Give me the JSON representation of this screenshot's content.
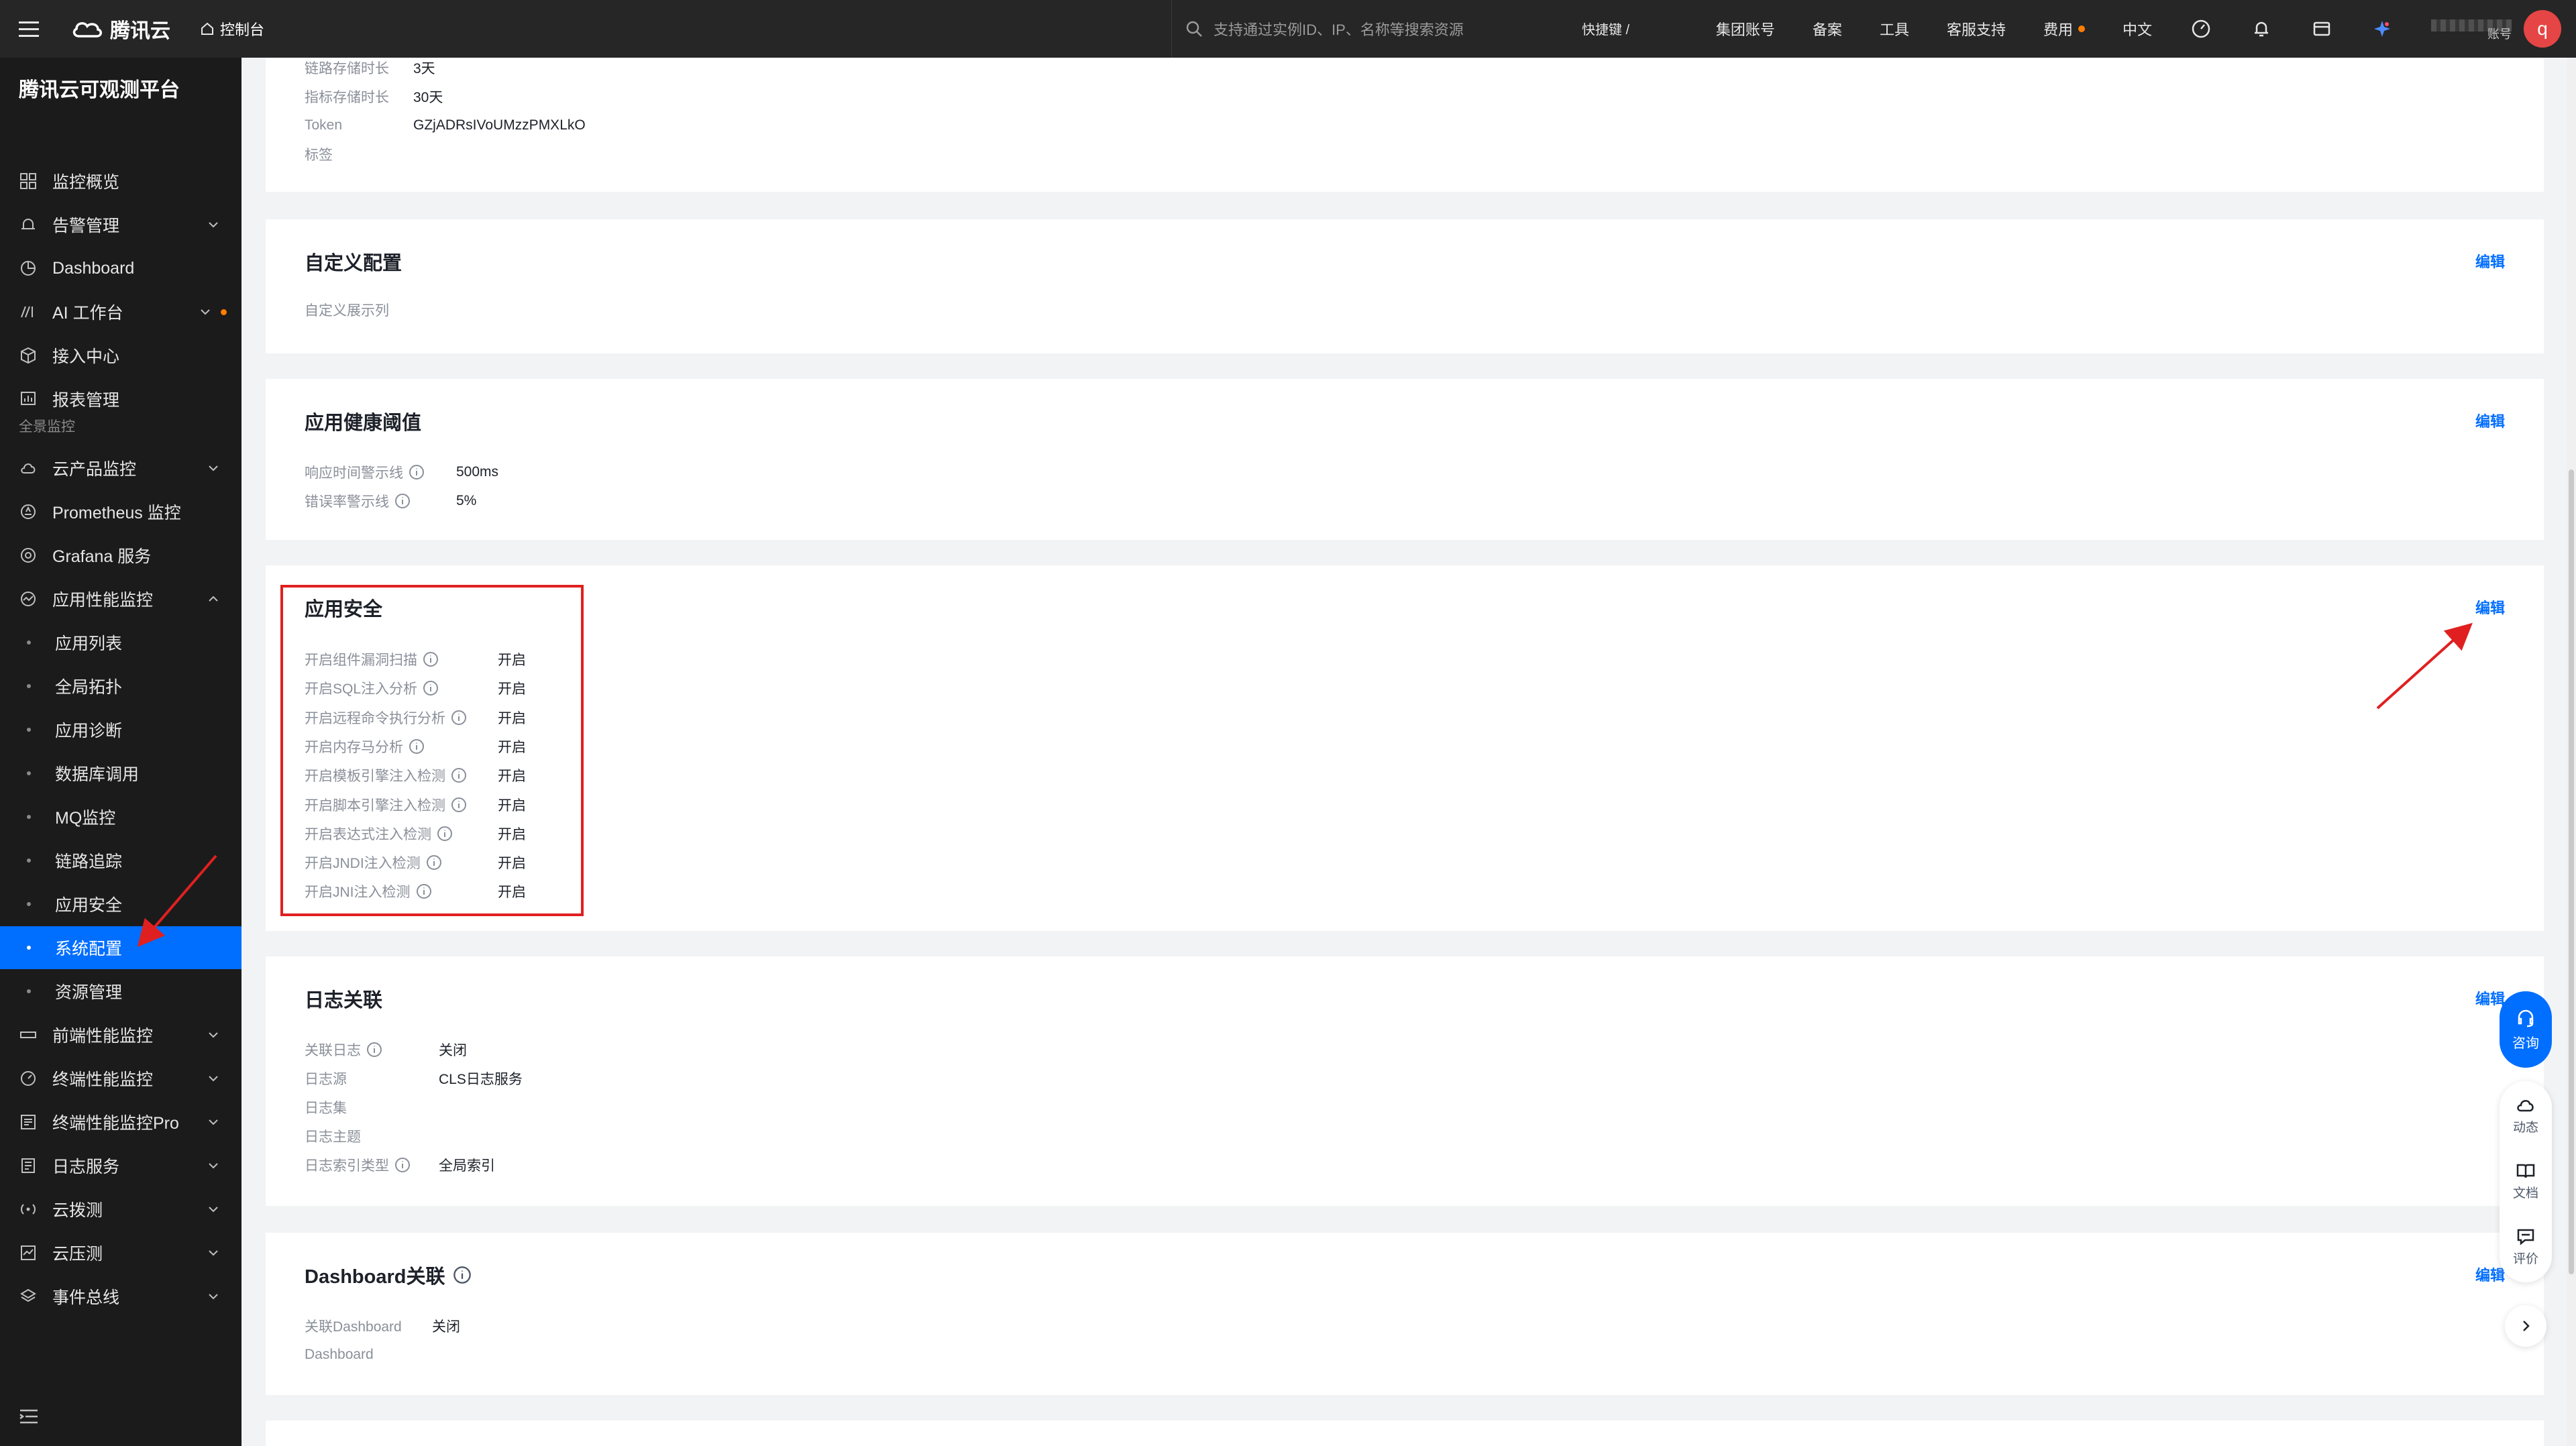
{
  "topbar": {
    "brand": "腾讯云",
    "console": "控制台",
    "search_placeholder": "支持通过实例ID、IP、名称等搜索资源",
    "shortcut": "快捷键 /",
    "links": [
      "集团账号",
      "备案",
      "工具",
      "客服支持",
      "费用",
      "中文"
    ],
    "account_label": "账号",
    "avatar_letter": "q"
  },
  "sidebar": {
    "title": "腾讯云可观测平台",
    "items": [
      {
        "label": "监控概览",
        "icon": "dashboard-grid-icon"
      },
      {
        "label": "告警管理",
        "icon": "alarm-icon",
        "expandable": true
      },
      {
        "label": "Dashboard",
        "icon": "pie-chart-icon"
      },
      {
        "label": "AI 工作台",
        "icon": "ai-icon",
        "expandable": true,
        "badge_dot": true
      },
      {
        "label": "接入中心",
        "icon": "cube-icon"
      },
      {
        "label": "报表管理",
        "icon": "report-icon"
      }
    ],
    "section_label": "全景监控",
    "section_items": [
      {
        "label": "云产品监控",
        "icon": "cloud-icon",
        "expandable": true
      },
      {
        "label": "Prometheus 监控",
        "icon": "prometheus-icon"
      },
      {
        "label": "Grafana 服务",
        "icon": "grafana-icon"
      },
      {
        "label": "应用性能监控",
        "icon": "apm-icon",
        "expanded": true
      }
    ],
    "sub_items": [
      {
        "label": "应用列表"
      },
      {
        "label": "全局拓扑"
      },
      {
        "label": "应用诊断"
      },
      {
        "label": "数据库调用"
      },
      {
        "label": "MQ监控"
      },
      {
        "label": "链路追踪"
      },
      {
        "label": "应用安全"
      },
      {
        "label": "系统配置",
        "active": true
      },
      {
        "label": "资源管理"
      }
    ],
    "more_items": [
      {
        "label": "前端性能监控",
        "icon": "rum-icon",
        "expandable": true
      },
      {
        "label": "终端性能监控",
        "icon": "gauge-icon",
        "expandable": true
      },
      {
        "label": "终端性能监控Pro",
        "icon": "terminal-pro-icon",
        "expandable": true
      },
      {
        "label": "日志服务",
        "icon": "log-icon",
        "expandable": true
      },
      {
        "label": "云拨测",
        "icon": "probe-icon",
        "expandable": true
      },
      {
        "label": "云压测",
        "icon": "pressure-test-icon",
        "expandable": true
      },
      {
        "label": "事件总线",
        "icon": "event-bus-icon",
        "expandable": true
      }
    ]
  },
  "basic": {
    "rows": [
      {
        "k": "链路存储时长",
        "v": "3天"
      },
      {
        "k": "指标存储时长",
        "v": "30天"
      },
      {
        "k": "Token",
        "v": "GZjADRsIVoUMzzPMXLkO"
      },
      {
        "k": "标签",
        "v": ""
      }
    ]
  },
  "custom": {
    "title": "自定义配置",
    "edit": "编辑",
    "row_label": "自定义展示列"
  },
  "health": {
    "title": "应用健康阈值",
    "edit": "编辑",
    "rows": [
      {
        "k": "响应时间警示线",
        "v": "500ms"
      },
      {
        "k": "错误率警示线",
        "v": "5%"
      }
    ]
  },
  "security": {
    "title": "应用安全",
    "edit": "编辑",
    "rows": [
      {
        "k": "开启组件漏洞扫描",
        "v": "开启"
      },
      {
        "k": "开启SQL注入分析",
        "v": "开启"
      },
      {
        "k": "开启远程命令执行分析",
        "v": "开启"
      },
      {
        "k": "开启内存马分析",
        "v": "开启"
      },
      {
        "k": "开启模板引擎注入检测",
        "v": "开启"
      },
      {
        "k": "开启脚本引擎注入检测",
        "v": "开启"
      },
      {
        "k": "开启表达式注入检测",
        "v": "开启"
      },
      {
        "k": "开启JNDI注入检测",
        "v": "开启"
      },
      {
        "k": "开启JNI注入检测",
        "v": "开启"
      }
    ]
  },
  "log": {
    "title": "日志关联",
    "edit": "编辑",
    "rows": [
      {
        "k": "关联日志",
        "v": "关闭",
        "info": true
      },
      {
        "k": "日志源",
        "v": "CLS日志服务"
      },
      {
        "k": "日志集",
        "v": ""
      },
      {
        "k": "日志主题",
        "v": ""
      },
      {
        "k": "日志索引类型",
        "v": "全局索引",
        "info": true
      }
    ]
  },
  "dashboard_link": {
    "title": "Dashboard关联",
    "edit": "编辑",
    "rows": [
      {
        "k": "关联Dashboard",
        "v": "关闭"
      },
      {
        "k": "Dashboard",
        "v": ""
      }
    ]
  },
  "float_tools": {
    "consult": "咨询",
    "activity": "动态",
    "docs": "文档",
    "review": "评价"
  },
  "colors": {
    "accent": "#006eff",
    "highlight_box": "#e02020",
    "sidebar_bg": "#1b1b1b",
    "topbar_bg": "#262626"
  }
}
